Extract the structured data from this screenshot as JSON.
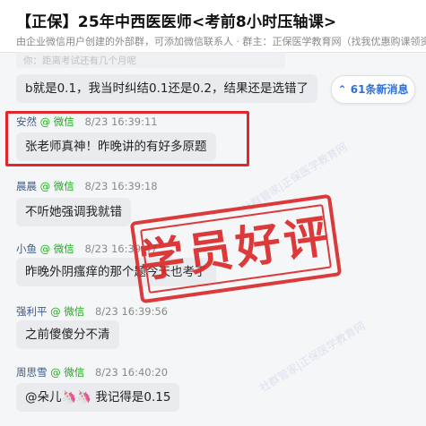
{
  "header": {
    "title": "【正保】25年中西医医师<考前8小时压轴课>",
    "subtitle": "由企业微信用户创建的外部群，可添加微信联系人 · 群主：正保医学教育网（找我优惠购课领资料"
  },
  "quoted_preview": "你：距离考试还有几个月呢",
  "new_messages_label": "61条新消息",
  "stamp_text": "学员好评",
  "watermark_text": "社群管家|正保医学教育网",
  "messages": [
    {
      "name": "",
      "source": "",
      "time": "",
      "text": "b就是0.1，我当时纠结0.1还是0.2，结果还是选错了"
    },
    {
      "name": "安然",
      "source": "@ 微信",
      "time": "8/23 16:39:11",
      "text": "张老师真神！昨晚讲的有好多原题"
    },
    {
      "name": "晨晨",
      "source": "@ 微信",
      "time": "8/23 16:39:18",
      "text": "不听她强调我就错"
    },
    {
      "name": "小鱼",
      "source": "@ 微信",
      "time": "8/23 16:39:47",
      "text": "昨晚外阴瘙痒的那个题今天也考了"
    },
    {
      "name": "强利平",
      "source": "@ 微信",
      "time": "8/23 16:39:56",
      "text": "之前傻傻分不清"
    },
    {
      "name": "周思雪",
      "source": "@ 微信",
      "time": "8/23 16:40:20",
      "text": "@朵儿🦄🦄 我记得是0.15"
    }
  ]
}
